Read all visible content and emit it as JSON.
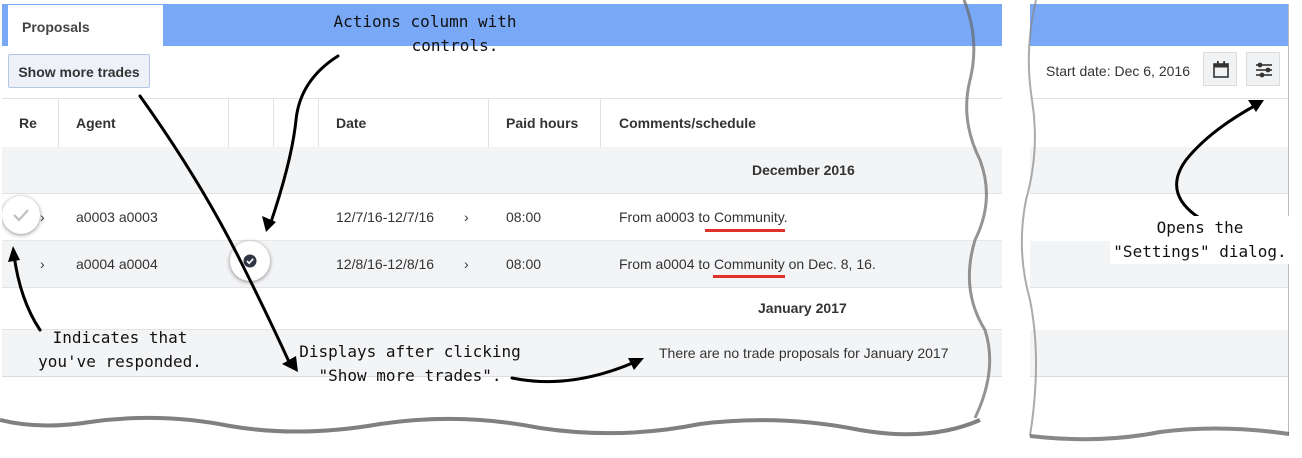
{
  "tab": {
    "label": "Proposals"
  },
  "toolbar": {
    "show_more_label": "Show more trades",
    "start_date": "Start date: Dec 6, 2016"
  },
  "table": {
    "headers": [
      "Re",
      "Agent",
      "Date",
      "Paid hours",
      "Comments/schedule"
    ],
    "groups": [
      {
        "label": "December 2016",
        "rows": [
          {
            "agent": "a0003 a0003",
            "date": "12/7/16-12/7/16",
            "paid_hours": "08:00",
            "comment_prefix": "From a0003 to ",
            "comment_link": "Community",
            "comment_suffix": "."
          },
          {
            "agent": "a0004 a0004",
            "date": "12/8/16-12/8/16",
            "paid_hours": "08:00",
            "comment_prefix": "From a0004 to ",
            "comment_link": "Community",
            "comment_suffix": " on Dec. 8, 16."
          }
        ]
      },
      {
        "label": "January 2017",
        "empty_message": "There are no trade proposals for January 2017"
      }
    ]
  },
  "annotations": {
    "actions_column": [
      "Actions column with",
      "controls."
    ],
    "responded": [
      "Indicates that",
      "you've responded."
    ],
    "displays_after": [
      "Displays after clicking",
      "\"Show more trades\"."
    ],
    "settings": [
      "Opens the",
      "\"Settings\" dialog."
    ]
  },
  "icons": {
    "chevron": "›",
    "calendar": "calendar-icon",
    "settings": "sliders-icon",
    "responded": "check-icon"
  },
  "colors": {
    "header_bar": "#79a8f7",
    "underline": "#e0312a",
    "group_row": "#f3f4f6"
  }
}
